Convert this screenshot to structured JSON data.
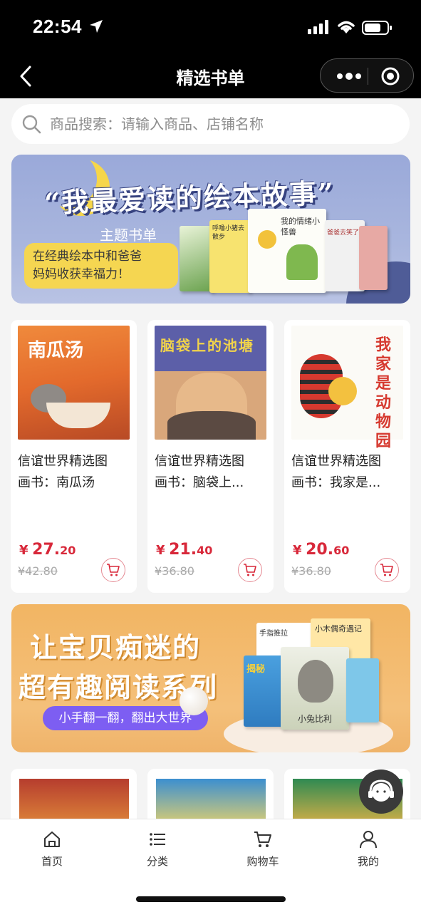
{
  "status_bar": {
    "time": "22:54"
  },
  "nav": {
    "title": "精选书单"
  },
  "search": {
    "placeholder": "商品搜索：请输入商品、店铺名称"
  },
  "banner_top": {
    "title": "“我最爱读的绘本故事”",
    "subtitle": "主题书单",
    "tagline_line1": "在经典绘本中和爸爸",
    "tagline_line2": "妈妈收获幸福力！",
    "book_text_1": "呼噜小猪去散步",
    "book_text_2": "我的情绪小怪兽",
    "book_text_3": "爸爸去笑了"
  },
  "products": [
    {
      "cover_title": "南瓜汤",
      "name_line1": "信谊世界精选图",
      "name_line2": "画书：南瓜汤",
      "price_currency": "¥",
      "price_int": "27.",
      "price_dec": "20",
      "original_price": "¥42.80"
    },
    {
      "cover_title": "脑袋上的池塘",
      "name_line1": "信谊世界精选图",
      "name_line2": "画书：脑袋上...",
      "price_currency": "¥",
      "price_int": "21.",
      "price_dec": "40",
      "original_price": "¥36.80"
    },
    {
      "cover_title": "我家是动物园",
      "name_line1": "信谊世界精选图",
      "name_line2": "画书：我家是...",
      "price_currency": "¥",
      "price_int": "20.",
      "price_dec": "60",
      "original_price": "¥36.80"
    }
  ],
  "banner_bottom": {
    "line1": "让宝贝痴迷的",
    "line2": "超有趣阅读系列",
    "tagline": "小手翻一翻，翻出大世界",
    "book_text_1": "手指推拉",
    "book_text_2": "小木偶奇遇记",
    "book_text_3": "揭秘",
    "book_text_4": "小兔比利"
  },
  "tabbar": {
    "items": [
      {
        "label": "首页",
        "icon": "home-icon"
      },
      {
        "label": "分类",
        "icon": "list-icon"
      },
      {
        "label": "购物车",
        "icon": "cart-icon"
      },
      {
        "label": "我的",
        "icon": "user-icon"
      }
    ]
  },
  "colors": {
    "price_red": "#d8283a",
    "purple_pill": "#7d5ef2",
    "yellow_pill": "#f5d651"
  }
}
